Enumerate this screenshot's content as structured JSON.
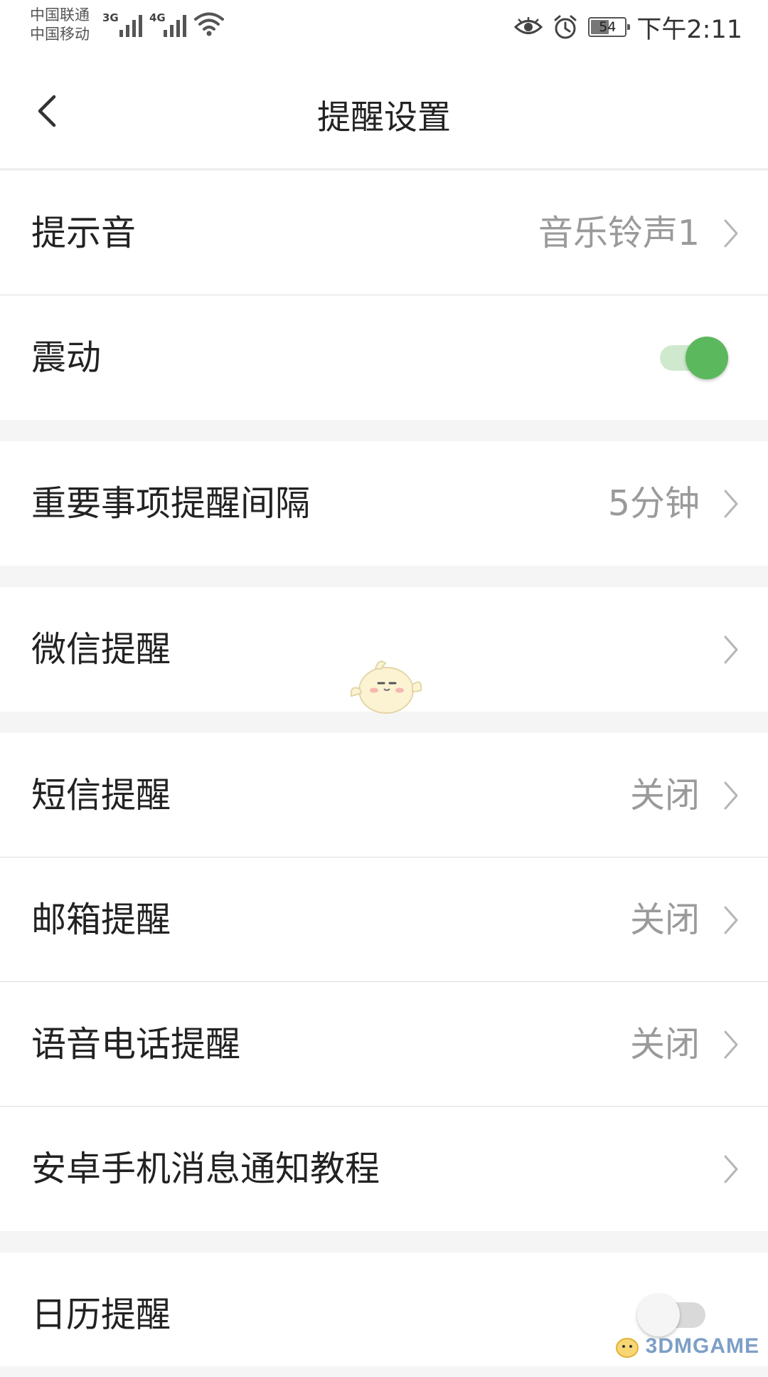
{
  "status_bar": {
    "carrier_1": "中国联通",
    "carrier_2": "中国移动",
    "network_1": "3G",
    "network_2": "4G",
    "battery_level": "54",
    "battery_percent": 54,
    "time": "下午2:11",
    "icons": [
      "signal-3g-icon",
      "signal-4g-icon",
      "wifi-icon",
      "eye-icon",
      "alarm-icon",
      "battery-icon"
    ]
  },
  "header": {
    "title": "提醒设置",
    "back_icon": "chevron-left-icon"
  },
  "settings": {
    "sound": {
      "label": "提示音",
      "value": "音乐铃声1"
    },
    "vibrate": {
      "label": "震动",
      "enabled": true
    },
    "important_interval": {
      "label": "重要事项提醒间隔",
      "value": "5分钟"
    },
    "wechat": {
      "label": "微信提醒",
      "value": ""
    },
    "sms": {
      "label": "短信提醒",
      "value": "关闭"
    },
    "email": {
      "label": "邮箱提醒",
      "value": "关闭"
    },
    "voice_call": {
      "label": "语音电话提醒",
      "value": "关闭"
    },
    "android_tutorial": {
      "label": "安卓手机消息通知教程",
      "value": ""
    },
    "calendar": {
      "label": "日历提醒",
      "enabled": false
    }
  },
  "watermark": {
    "text": "3DMGAME"
  },
  "colors": {
    "accent_green": "#5cb85c",
    "accent_green_track": "#cfe9cf",
    "toggle_off_track": "#d9d9d9",
    "toggle_off_knob": "#f5f5f5",
    "value_gray": "#9a9a9a",
    "background": "#f5f5f5"
  }
}
